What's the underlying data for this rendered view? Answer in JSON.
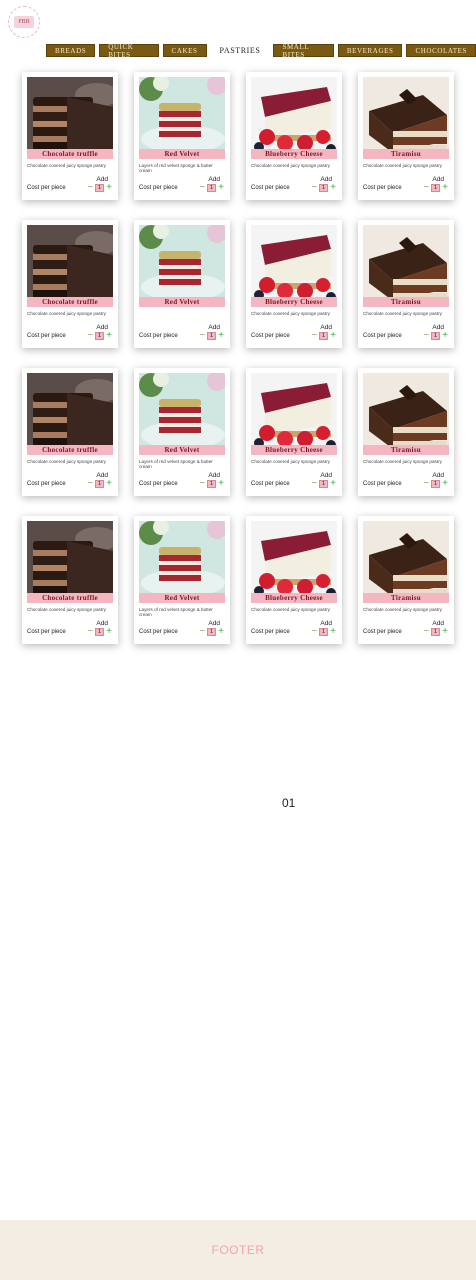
{
  "logo": {
    "text": "FBB"
  },
  "nav": {
    "tabs": [
      {
        "label": "BREADS",
        "active": false
      },
      {
        "label": "QUICK BITES",
        "active": false
      },
      {
        "label": "CAKES",
        "active": false
      },
      {
        "label": "PASTRIES",
        "active": true
      },
      {
        "label": "SMALL BITES",
        "active": false
      },
      {
        "label": "BEVERAGES",
        "active": false
      },
      {
        "label": "CHOCOLATES",
        "active": false
      }
    ]
  },
  "products": [
    {
      "name": "Chocolate truffle",
      "desc": "Chocolate covered juicy sponge pastry",
      "add": "Add",
      "cost": "Cost per piece",
      "qty": "1",
      "image": "chocolate-truffle"
    },
    {
      "name": "Red Velvet",
      "desc": "Layers of red velvet sponge & butter cream",
      "add": "Add",
      "cost": "Cost per piece",
      "qty": "1",
      "image": "red-velvet"
    },
    {
      "name": "Blueberry Cheese",
      "desc": "Chocolate covered juicy sponge pastry",
      "add": "Add",
      "cost": "Cost per piece",
      "qty": "1",
      "image": "blueberry-cheese"
    },
    {
      "name": "Tiramisu",
      "desc": "Chocolate covered juicy sponge pastry",
      "add": "Add",
      "cost": "Cost per piece",
      "qty": "1",
      "image": "tiramisu"
    },
    {
      "name": "Chocolate truffle",
      "desc": "Chocolate covered juicy sponge pastry",
      "add": "Add",
      "cost": "Cost per piece",
      "qty": "1",
      "image": "chocolate-truffle"
    },
    {
      "name": "Red Velvet",
      "desc": "",
      "add": "Add",
      "cost": "Cost per piece",
      "qty": "1",
      "image": "red-velvet"
    },
    {
      "name": "Blueberry Cheese",
      "desc": "Chocolate covered juicy sponge pastry",
      "add": "Add",
      "cost": "Cost per piece",
      "qty": "1",
      "image": "blueberry-cheese"
    },
    {
      "name": "Tiramisu",
      "desc": "Chocolate covered juicy sponge pastry",
      "add": "Add",
      "cost": "Cost per piece",
      "qty": "1",
      "image": "tiramisu"
    },
    {
      "name": "Chocolate truffle",
      "desc": "Chocolate covered juicy sponge pastry",
      "add": "Add",
      "cost": "Cost per piece",
      "qty": "1",
      "image": "chocolate-truffle"
    },
    {
      "name": "Red Velvet",
      "desc": "Layers of red velvet sponge & butter cream",
      "add": "Add",
      "cost": "Cost per piece",
      "qty": "1",
      "image": "red-velvet"
    },
    {
      "name": "Blueberry Cheese",
      "desc": "Chocolate covered juicy sponge pastry",
      "add": "Add",
      "cost": "Cost per piece",
      "qty": "1",
      "image": "blueberry-cheese"
    },
    {
      "name": "Tiramisu",
      "desc": "Chocolate covered juicy sponge pastry",
      "add": "Add",
      "cost": "Cost per piece",
      "qty": "1",
      "image": "tiramisu"
    },
    {
      "name": "Chocolate truffle",
      "desc": "Chocolate covered juicy sponge pastry",
      "add": "Add",
      "cost": "Cost per piece",
      "qty": "1",
      "image": "chocolate-truffle"
    },
    {
      "name": "Red Velvet",
      "desc": "Layers of red velvet sponge & butter cream",
      "add": "Add",
      "cost": "Cost per piece",
      "qty": "1",
      "image": "red-velvet"
    },
    {
      "name": "Blueberry Cheese",
      "desc": "Chocolate covered juicy sponge pastry",
      "add": "Add",
      "cost": "Cost per piece",
      "qty": "1",
      "image": "blueberry-cheese"
    },
    {
      "name": "Tiramisu",
      "desc": "Chocolate covered juicy sponge pastry",
      "add": "Add",
      "cost": "Cost per piece",
      "qty": "1",
      "image": "tiramisu"
    }
  ],
  "pagination": {
    "current": "01"
  },
  "footer": {
    "label": "FOOTER"
  },
  "colors": {
    "nav_bg": "#7a5a12",
    "label_bg": "#f4b6c0",
    "plus": "#45b443",
    "footer_bg": "#f3ede4",
    "footer_text": "#f0a5b3"
  }
}
